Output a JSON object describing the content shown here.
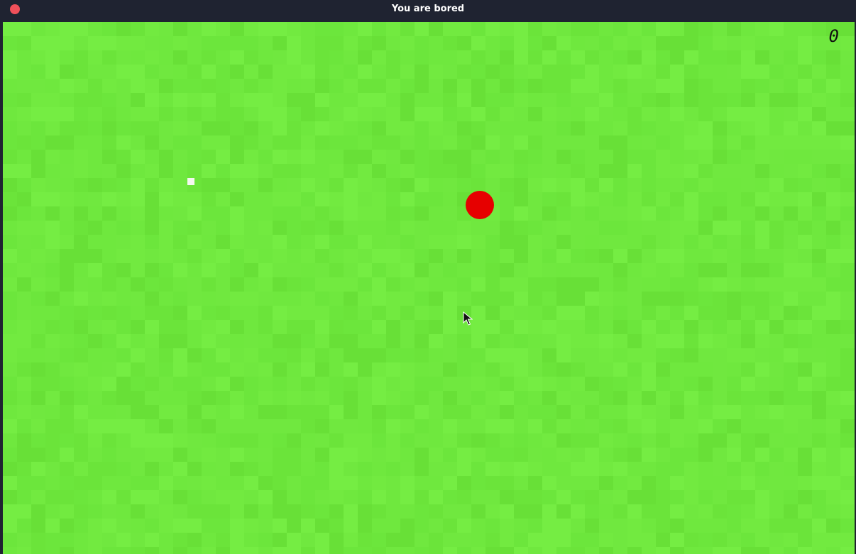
{
  "window": {
    "title": "You are bored"
  },
  "game": {
    "score": "0",
    "colors": {
      "grass_base": "#6fe83e",
      "player": "#e60000",
      "pellet": "#f4f7ef"
    },
    "icons": {
      "close": "close-icon",
      "cursor": "mouse-cursor-icon"
    }
  }
}
